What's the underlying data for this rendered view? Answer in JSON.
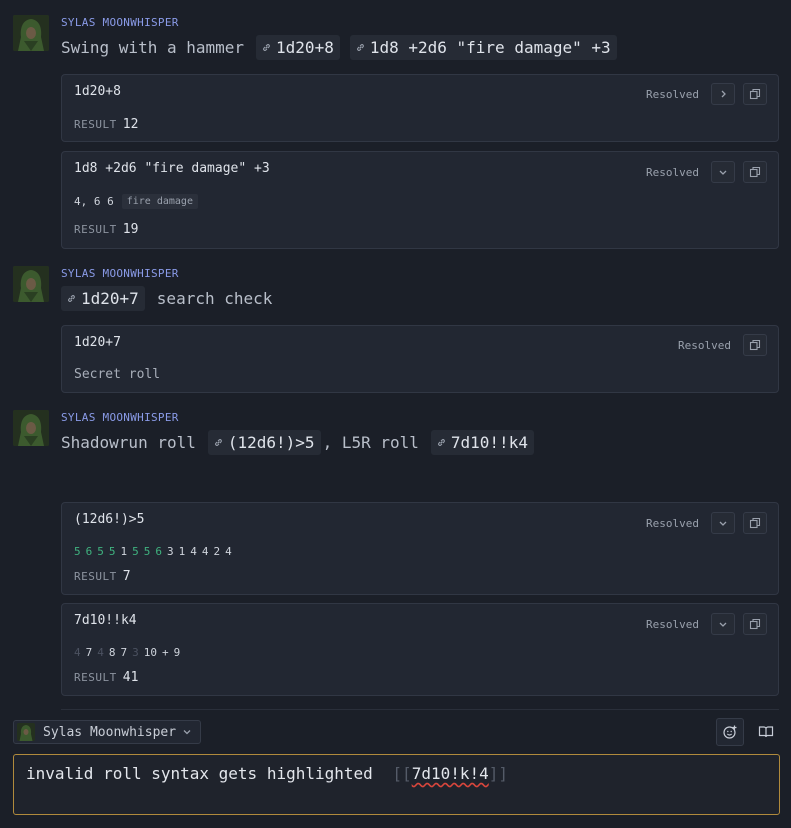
{
  "colors": {
    "accent_author": "#8a9be8",
    "success": "#3fb27f",
    "focus_border": "#b08a3c",
    "error_underline": "#d9463c"
  },
  "messages": [
    {
      "author": "SYLAS MOONWHISPER",
      "text_before": "Swing with a hammer",
      "chips": [
        "1d20+8",
        "1d8 +2d6 \"fire damage\" +3"
      ],
      "cards": [
        {
          "expr": "1d20+8",
          "status": "Resolved",
          "result_label": "RESULT",
          "result": "12"
        },
        {
          "expr": "1d8 +2d6 \"fire damage\" +3",
          "status": "Resolved",
          "dice": "4, 6 6",
          "tag": "fire damage",
          "result_label": "RESULT",
          "result": "19"
        }
      ]
    },
    {
      "author": "SYLAS MOONWHISPER",
      "chip": "1d20+7",
      "text_after": "search check",
      "cards": [
        {
          "expr": "1d20+7",
          "status": "Resolved",
          "note": "Secret roll"
        }
      ]
    },
    {
      "author": "SYLAS MOONWHISPER",
      "text_a": "Shadowrun roll",
      "chip_a": "(12d6!)>5",
      "text_b": ", L5R roll",
      "chip_b": "7d10!!k4",
      "cards": [
        {
          "expr": "(12d6!)>5",
          "status": "Resolved",
          "dice": [
            "5",
            "6",
            "5",
            "5",
            "1",
            "5",
            "5",
            "6",
            "3",
            "1",
            "4",
            "4",
            "2",
            "4"
          ],
          "result_label": "RESULT",
          "result": "7"
        },
        {
          "expr": "7d10!!k4",
          "status": "Resolved",
          "dice": [
            "4",
            "7",
            "4",
            "8",
            "7",
            "3",
            "10",
            "+",
            "9"
          ],
          "result_label": "RESULT",
          "result": "41"
        }
      ]
    }
  ],
  "composer": {
    "character": "Sylas Moonwhisper",
    "text": "invalid roll syntax gets highlighted",
    "open_bracket": "[[",
    "roll": "7d10!k!4",
    "close_bracket": "]]"
  },
  "icons": [
    "link-icon",
    "chevron-right-icon",
    "chevron-down-icon",
    "copy-icon",
    "emoji-add-icon",
    "book-icon"
  ]
}
